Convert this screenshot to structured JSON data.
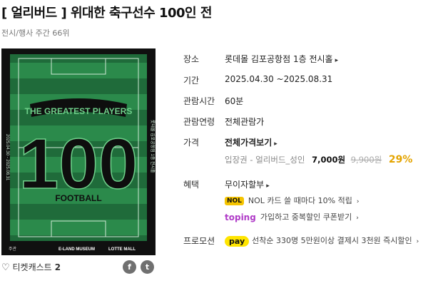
{
  "header": {
    "title": "[ 얼리버드 ]  위대한 축구선수 100인 전",
    "subtitle": "전시/행사 주간 66위"
  },
  "poster": {
    "headline": "THE GREATEST PLAYERS",
    "number": "100",
    "word": "FOOTBALL",
    "side_left": "2025.04.30 - 2025.08.31",
    "side_right": "롯데몰 김포공항점 1층 전시홀",
    "brand_left": "주관",
    "brand_mid": "E-LAND MUSEUM",
    "brand_right": "LOTTE MALL",
    "colors": {
      "field_dark": "#1f6b3a",
      "field_light": "#2b8a4b",
      "ink": "#0e0e0e"
    }
  },
  "info": {
    "venue_label": "장소",
    "venue_value": "롯데몰 김포공항점 1층 전시홀",
    "period_label": "기간",
    "period_value": "2025.04.30 ~2025.08.31",
    "duration_label": "관람시간",
    "duration_value": "60분",
    "age_label": "관람연령",
    "age_value": "전체관람가",
    "price_label": "가격",
    "price_link": "전체가격보기",
    "price_item": "입장권 - 얼리버드_성인",
    "price_now": "7,000원",
    "price_orig": "9,900원",
    "price_discount": "29%",
    "benefit_label": "혜택",
    "benefit_value": "무이자할부",
    "benefit_nol": "NOL 카드 쓸 때마다 10% 적립",
    "nol_logo": "NOL",
    "benefit_toping": "가입하고 중복할인 쿠폰받기",
    "toping_logo": "toping",
    "promo_label": "프로모션",
    "promo_text": "선착순 330명 5만원이상 결제시 3천원 즉시할인",
    "pay_logo": "pay"
  },
  "footer": {
    "like_label": "티켓캐스트",
    "like_count": "2",
    "facebook": "f",
    "twitter": "t"
  },
  "colors": {
    "discount": "#e4a400",
    "nol_yellow": "#f5c400",
    "toping_purple": "#b03cc8",
    "pay_yellow": "#ffe500"
  }
}
